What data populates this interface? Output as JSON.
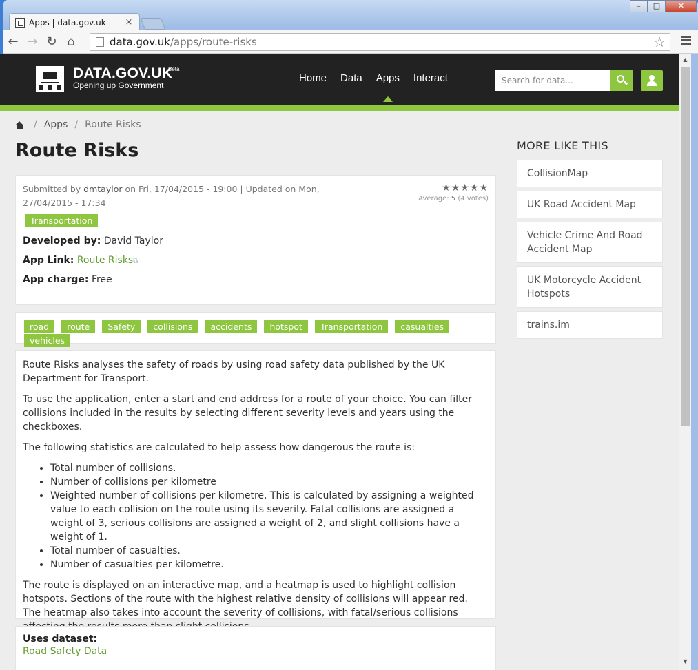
{
  "browser": {
    "tab_title": "Apps | data.gov.uk",
    "tab_close": "×",
    "url_domain": "data.gov.uk",
    "url_path": "/apps/route-risks",
    "window_controls": [
      "–",
      "□",
      "✕"
    ]
  },
  "site": {
    "name": "DATA.GOV.UK",
    "beta": "Beta",
    "tagline": "Opening up Government",
    "nav": [
      "Home",
      "Data",
      "Apps",
      "Interact"
    ],
    "active_nav": "Apps",
    "search_placeholder": "Search for data...",
    "accent": "#8ec63f"
  },
  "breadcrumb": {
    "sep": "/",
    "link": "Apps",
    "current": "Route Risks"
  },
  "page_title": "Route Risks",
  "meta": {
    "submitted_prefix": "Submitted by",
    "author": "dmtaylor",
    "submitted_suffix": "on Fri, 17/04/2015 - 19:00 | Updated on Mon, 27/04/2015 - 17:34",
    "stars": "★★★★★",
    "avg_label": "Average:",
    "avg_value": "5",
    "votes": "(4 votes)",
    "category": "Transportation",
    "developed_label": "Developed by:",
    "developer": "David Taylor",
    "applink_label": "App Link:",
    "applink_text": "Route Risks",
    "ext_icon": "⧉",
    "charge_label": "App charge:",
    "charge_value": "Free"
  },
  "tags": [
    "road",
    "route",
    "Safety",
    "collisions",
    "accidents",
    "hotspot",
    "Transportation",
    "casualties",
    "vehicles"
  ],
  "description": {
    "p1": "Route Risks analyses the safety of roads by using road safety data published by the UK Department for Transport.",
    "p2": "To use the application, enter a start and end address for a route of your choice. You can filter collisions included in the results by selecting different severity levels and years using the checkboxes.",
    "p3": "The following statistics are calculated to help assess how dangerous the route is:",
    "bullets": [
      "Total number of collisions.",
      "Number of collisions per kilometre",
      "Weighted number of collisions per kilometre. This is calculated by assigning a weighted value to each collision on the route using its severity. Fatal collisions are assigned a weight of 3, serious collisions are assigned a weight of 2, and slight collisions have a weight of 1.",
      "Total number of casualties.",
      "Number of casualties per kilometre."
    ],
    "p4": "The route is displayed on an interactive map, and a heatmap is used to highlight collision hotspots. Sections of the route with the highest relative density of collisions will appear red. The heatmap also takes into account the severity of collisions, with fatal/serious collisions affecting the results more than slight collisions."
  },
  "dataset": {
    "label": "Uses dataset:",
    "name": "Road Safety Data"
  },
  "sidebar": {
    "title": "MORE LIKE THIS",
    "items": [
      "CollisionMap",
      "UK Road Accident Map",
      "Vehicle Crime And Road Accident Map",
      "UK Motorcycle Accident Hotspots",
      "trains.im"
    ]
  }
}
